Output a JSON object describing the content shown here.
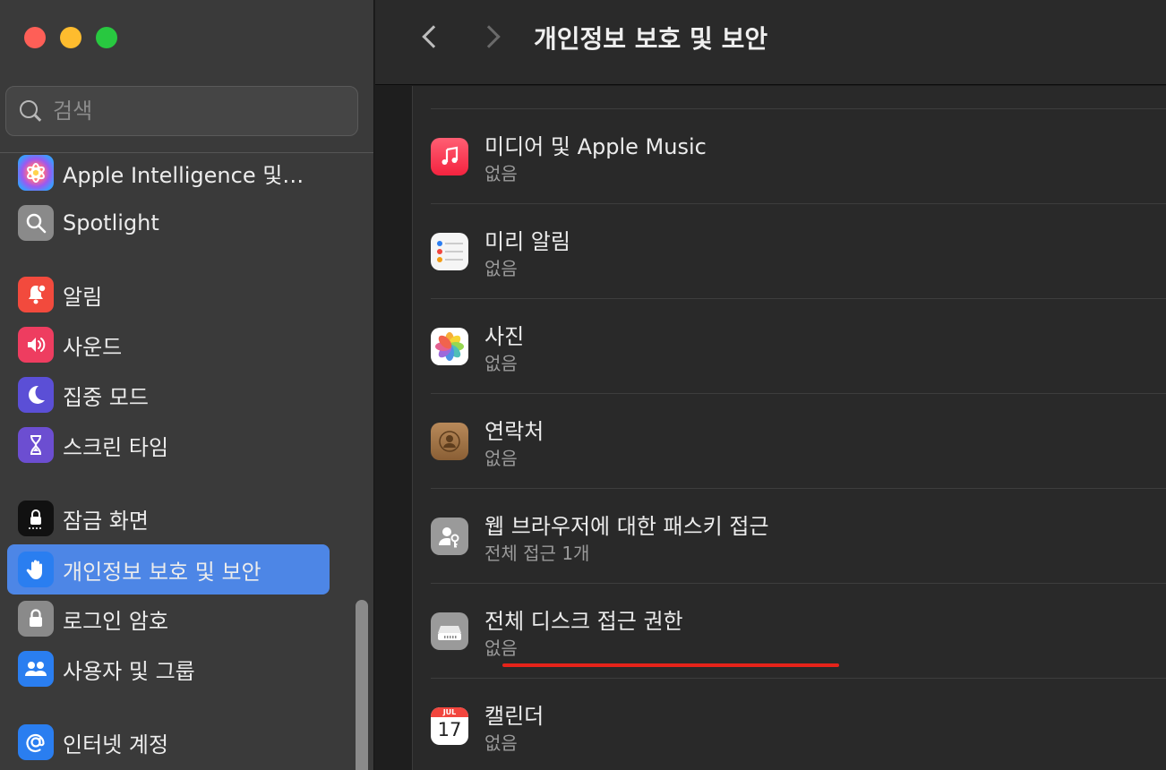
{
  "window": {
    "title": "개인정보 보호 및 보안"
  },
  "search": {
    "placeholder": "검색"
  },
  "sidebar": {
    "items": [
      {
        "label": "Apple Intelligence 및…",
        "icon": "apple-intelligence-icon",
        "color": "#b86ae8"
      },
      {
        "label": "Spotlight",
        "icon": "spotlight-icon",
        "color": "#8a8a8a"
      },
      {
        "label": "알림",
        "icon": "bell-icon",
        "color": "#f24a3d"
      },
      {
        "label": "사운드",
        "icon": "speaker-icon",
        "color": "#ee3d60"
      },
      {
        "label": "집중 모드",
        "icon": "moon-icon",
        "color": "#5b4fd6"
      },
      {
        "label": "스크린 타임",
        "icon": "hourglass-icon",
        "color": "#6c4ed1"
      },
      {
        "label": "잠금 화면",
        "icon": "lock-screen-icon",
        "color": "#111111"
      },
      {
        "label": "개인정보 보호 및 보안",
        "icon": "hand-icon",
        "color": "#2a7ef0",
        "active": true
      },
      {
        "label": "로그인 암호",
        "icon": "lock-icon",
        "color": "#8a8a8a"
      },
      {
        "label": "사용자 및 그룹",
        "icon": "users-icon",
        "color": "#2a7ef0"
      },
      {
        "label": "인터넷 계정",
        "icon": "at-icon",
        "color": "#2a7ef0"
      }
    ]
  },
  "main": {
    "rows": [
      {
        "title": "미디어 및 Apple Music",
        "subtitle": "없음",
        "icon": "music-icon"
      },
      {
        "title": "미리 알림",
        "subtitle": "없음",
        "icon": "reminders-icon"
      },
      {
        "title": "사진",
        "subtitle": "없음",
        "icon": "photos-icon"
      },
      {
        "title": "연락처",
        "subtitle": "없음",
        "icon": "contacts-icon"
      },
      {
        "title": "웹 브라우저에 대한 패스키 접근",
        "subtitle": "전체 접근 1개",
        "icon": "passkey-icon"
      },
      {
        "title": "전체 디스크 접근 권한",
        "subtitle": "없음",
        "icon": "disk-icon"
      },
      {
        "title": "캘린더",
        "subtitle": "없음",
        "icon": "calendar-icon",
        "calendar": {
          "month": "JUL",
          "day": "17"
        }
      }
    ]
  },
  "colors": {
    "accent": "#4d86e6",
    "highlight_underline": "#e5231a"
  }
}
